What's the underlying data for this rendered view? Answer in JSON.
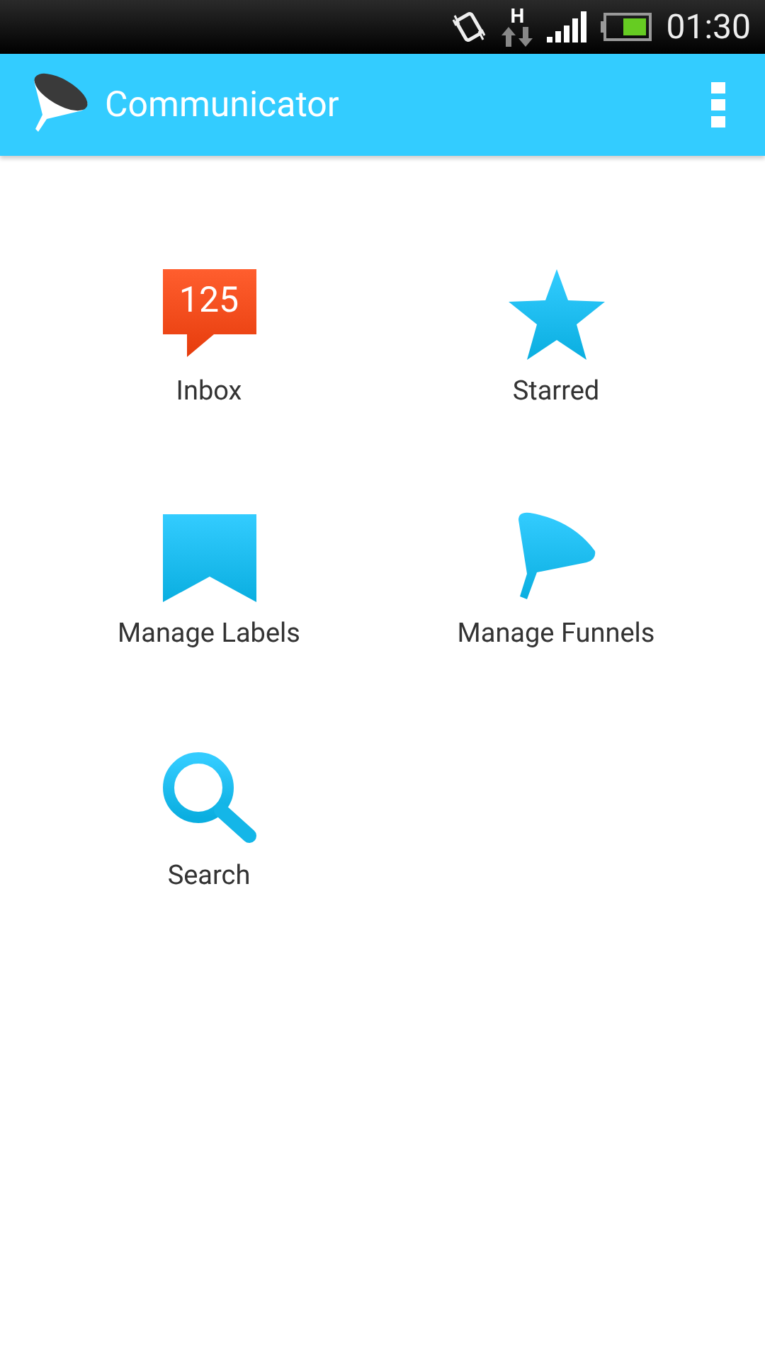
{
  "status_bar": {
    "network_type": "H",
    "time": "01:30"
  },
  "app_bar": {
    "title": "Communicator"
  },
  "tiles": [
    {
      "kind": "inbox",
      "label": "Inbox",
      "badge": "125"
    },
    {
      "kind": "starred",
      "label": "Starred"
    },
    {
      "kind": "labels",
      "label": "Manage Labels"
    },
    {
      "kind": "funnels",
      "label": "Manage Funnels"
    },
    {
      "kind": "search",
      "label": "Search"
    }
  ]
}
